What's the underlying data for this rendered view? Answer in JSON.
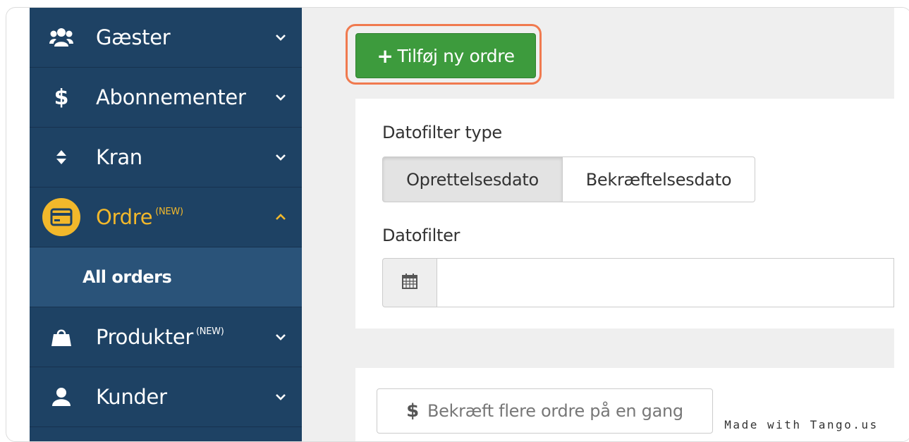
{
  "sidebar": {
    "items": [
      {
        "label": "Gæster",
        "icon": "users-icon",
        "badge": ""
      },
      {
        "label": "Abonnementer",
        "icon": "dollar-icon",
        "badge": ""
      },
      {
        "label": "Kran",
        "icon": "sort-icon",
        "badge": ""
      },
      {
        "label": "Ordre",
        "icon": "credit-card-icon",
        "badge": "(NEW)"
      },
      {
        "label": "Produkter",
        "icon": "shopping-bag-icon",
        "badge": "(NEW)"
      },
      {
        "label": "Kunder",
        "icon": "user-icon",
        "badge": ""
      }
    ],
    "sub_items": [
      {
        "label": "All orders"
      }
    ]
  },
  "toolbar": {
    "add_order_label": "Tilføj ny ordre"
  },
  "filters": {
    "date_filter_type_label": "Datofilter type",
    "options": [
      "Oprettelsesdato",
      "Bekræftelsesdato"
    ],
    "selected": "Oprettelsesdato",
    "date_filter_label": "Datofilter",
    "date_value": ""
  },
  "bulk": {
    "confirm_label": "Bekræft flere ordre på en gang"
  },
  "watermark": "Made with Tango.us",
  "colors": {
    "sidebar_bg": "#1e4264",
    "active_accent": "#f2b82b",
    "add_button": "#3d9b3d",
    "highlight": "#f07a4f"
  }
}
